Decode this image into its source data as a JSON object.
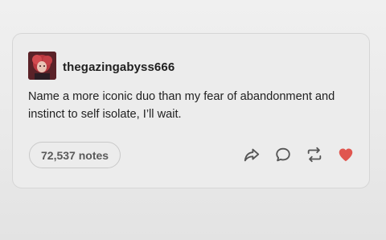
{
  "post": {
    "username": "thegazingabyss666",
    "text": "Name a more iconic duo than my fear of abandonment and instinct to self isolate, I’ll wait.",
    "notes_label": "72,537 notes"
  },
  "actions": {
    "share_icon": "share-icon",
    "reply_icon": "reply-icon",
    "reblog_icon": "reblog-icon",
    "like_icon": "heart-icon"
  },
  "colors": {
    "like_active": "#e0564f",
    "icon_gray": "#555555"
  }
}
